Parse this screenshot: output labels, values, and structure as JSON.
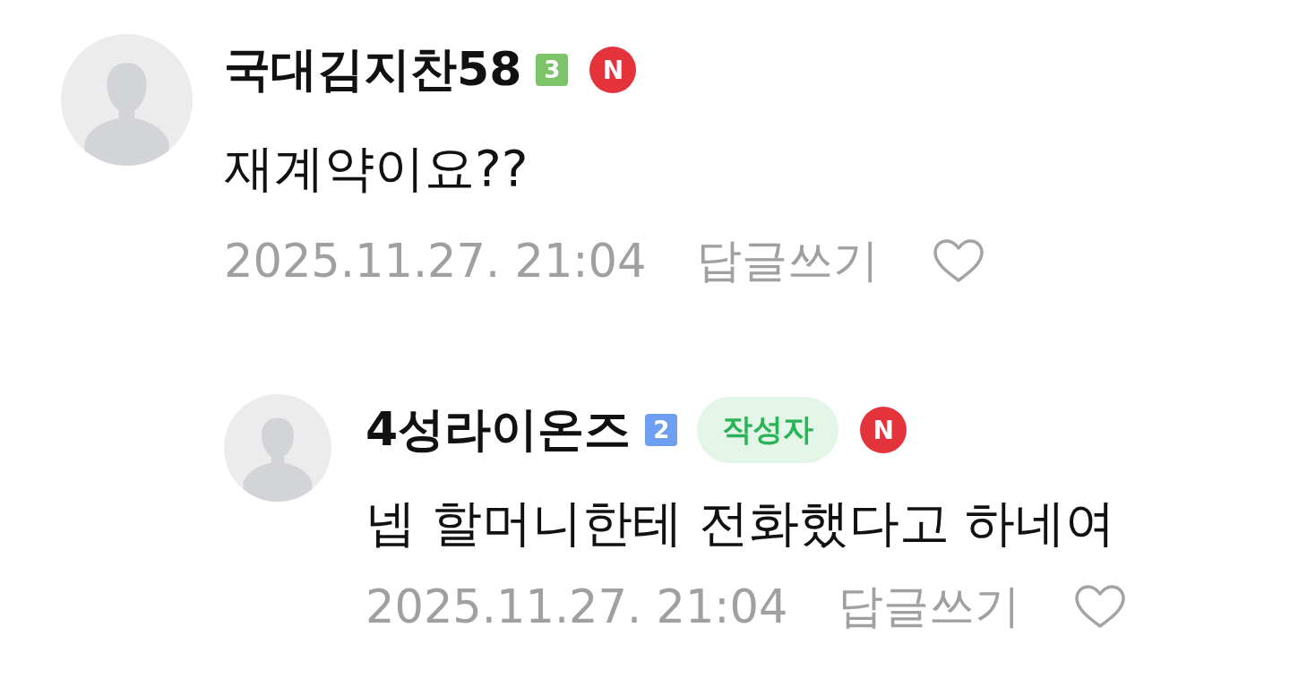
{
  "comments": [
    {
      "author": "국대김지찬58",
      "badges": [
        {
          "kind": "level",
          "text": "3",
          "color": "#7cc46a"
        },
        {
          "kind": "new",
          "text": "N"
        }
      ],
      "text": "재계약이요??",
      "date": "2025.11.27. 21:04",
      "reply_label": "답글쓰기",
      "liked": false,
      "replies": [
        {
          "author": "4성라이온즈",
          "badges": [
            {
              "kind": "level",
              "text": "2",
              "color": "#6f9ff0"
            },
            {
              "kind": "author",
              "text": "작성자"
            },
            {
              "kind": "new",
              "text": "N"
            }
          ],
          "text": "넵 할머니한테 전화했다고 하네여",
          "date": "2025.11.27. 21:04",
          "reply_label": "답글쓰기",
          "liked": false
        }
      ]
    }
  ]
}
